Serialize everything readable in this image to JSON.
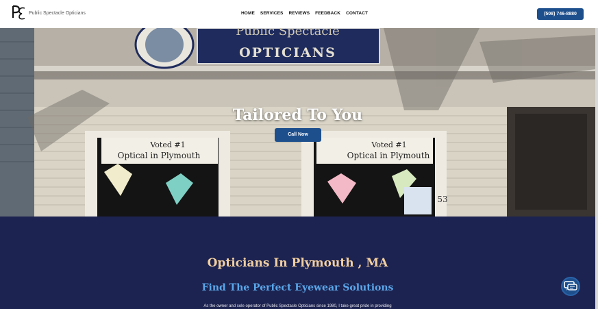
{
  "header": {
    "logo_text": "Public Spectacle Opticians",
    "nav": [
      "HOME",
      "SERVICES",
      "REVIEWS",
      "FEEDBACK",
      "CONTACT"
    ],
    "phone": "(508) 746-8880"
  },
  "hero": {
    "title": "Tailored To You",
    "cta": "Call Now",
    "sign_top": "Public Spectacle",
    "sign_bottom": "OPTICIANS",
    "poster_line1": "Voted #1",
    "poster_line2": "Optical in Plymouth",
    "house_number": "53"
  },
  "intro": {
    "heading": "Opticians In Plymouth , MA",
    "subheading": "Find The Perfect Eyewear Solutions",
    "paragraph": "As the owner and sole operator of Public Spectacle Opticians since 1980, I take great pride in providing"
  },
  "colors": {
    "brand_blue": "#1d4f8d",
    "navy": "#1d2350",
    "peach": "#f1cfa1",
    "sky": "#5aa6ea"
  }
}
